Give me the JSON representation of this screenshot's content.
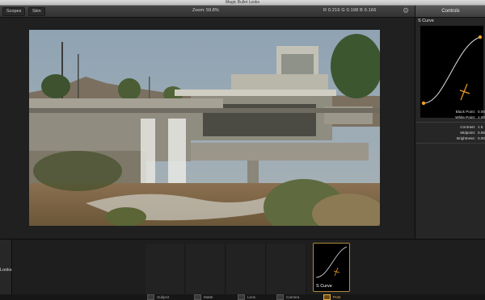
{
  "window": {
    "title": "Magic Bullet Looks"
  },
  "toolbar": {
    "scopes_label": "Scopes",
    "skin_label": "Skin",
    "zoom_text": "Zoom: 59.8%",
    "rgb_text": "R 0.216   G 0.198   B 0.166",
    "settings_icon": "gear-icon"
  },
  "controls": {
    "tab_label": "Controls",
    "panel_title": "S Curve",
    "params": [
      {
        "label": "Black Point:",
        "value": "0.00"
      },
      {
        "label": "White Point:",
        "value": "1.00"
      },
      {
        "label": "Contrast:",
        "value": "1.5"
      },
      {
        "label": "Midpoint:",
        "value": "0.65"
      },
      {
        "label": "Brightness:",
        "value": "0.00"
      }
    ]
  },
  "looks": {
    "tab_label": "Looks"
  },
  "tool_chain": {
    "selected_tool": "S Curve"
  },
  "categories": [
    {
      "label": "Subject",
      "active": false
    },
    {
      "label": "Matte",
      "active": false
    },
    {
      "label": "Lens",
      "active": false
    },
    {
      "label": "Camera",
      "active": false
    },
    {
      "label": "Post",
      "active": true
    }
  ],
  "colors": {
    "accent": "#e8b23d",
    "curve_point": "#f0a020"
  }
}
